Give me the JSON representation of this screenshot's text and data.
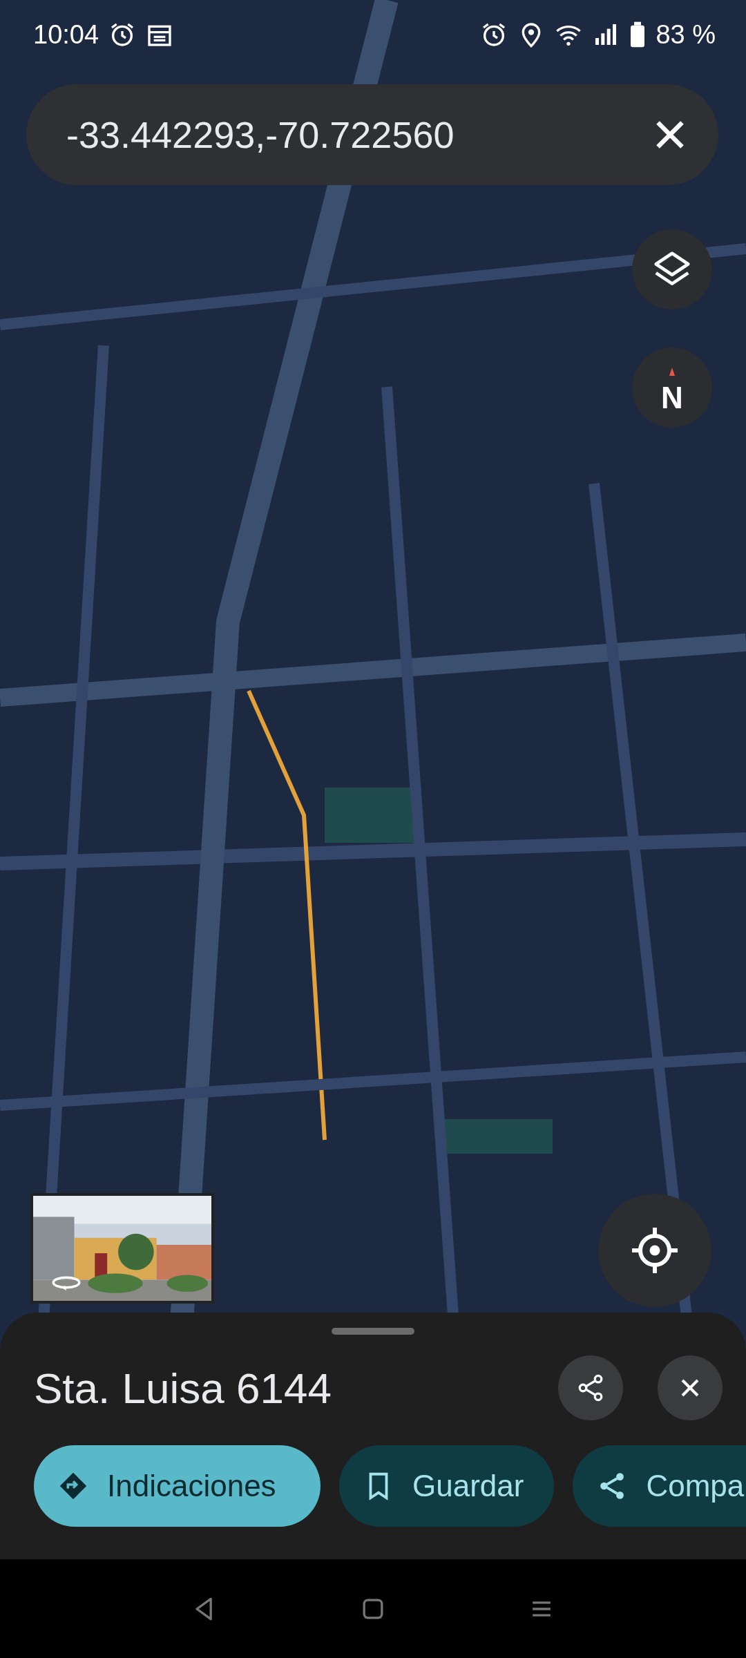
{
  "status_bar": {
    "time": "10:04",
    "battery": "83 %"
  },
  "search": {
    "value": "-33.442293,-70.722560"
  },
  "compass": {
    "label": "N"
  },
  "place": {
    "title": "Sta. Luisa 6144"
  },
  "actions": [
    {
      "label": "Indicaciones",
      "kind": "directions"
    },
    {
      "label": "Guardar",
      "kind": "save"
    },
    {
      "label": "Compa",
      "kind": "share"
    }
  ]
}
